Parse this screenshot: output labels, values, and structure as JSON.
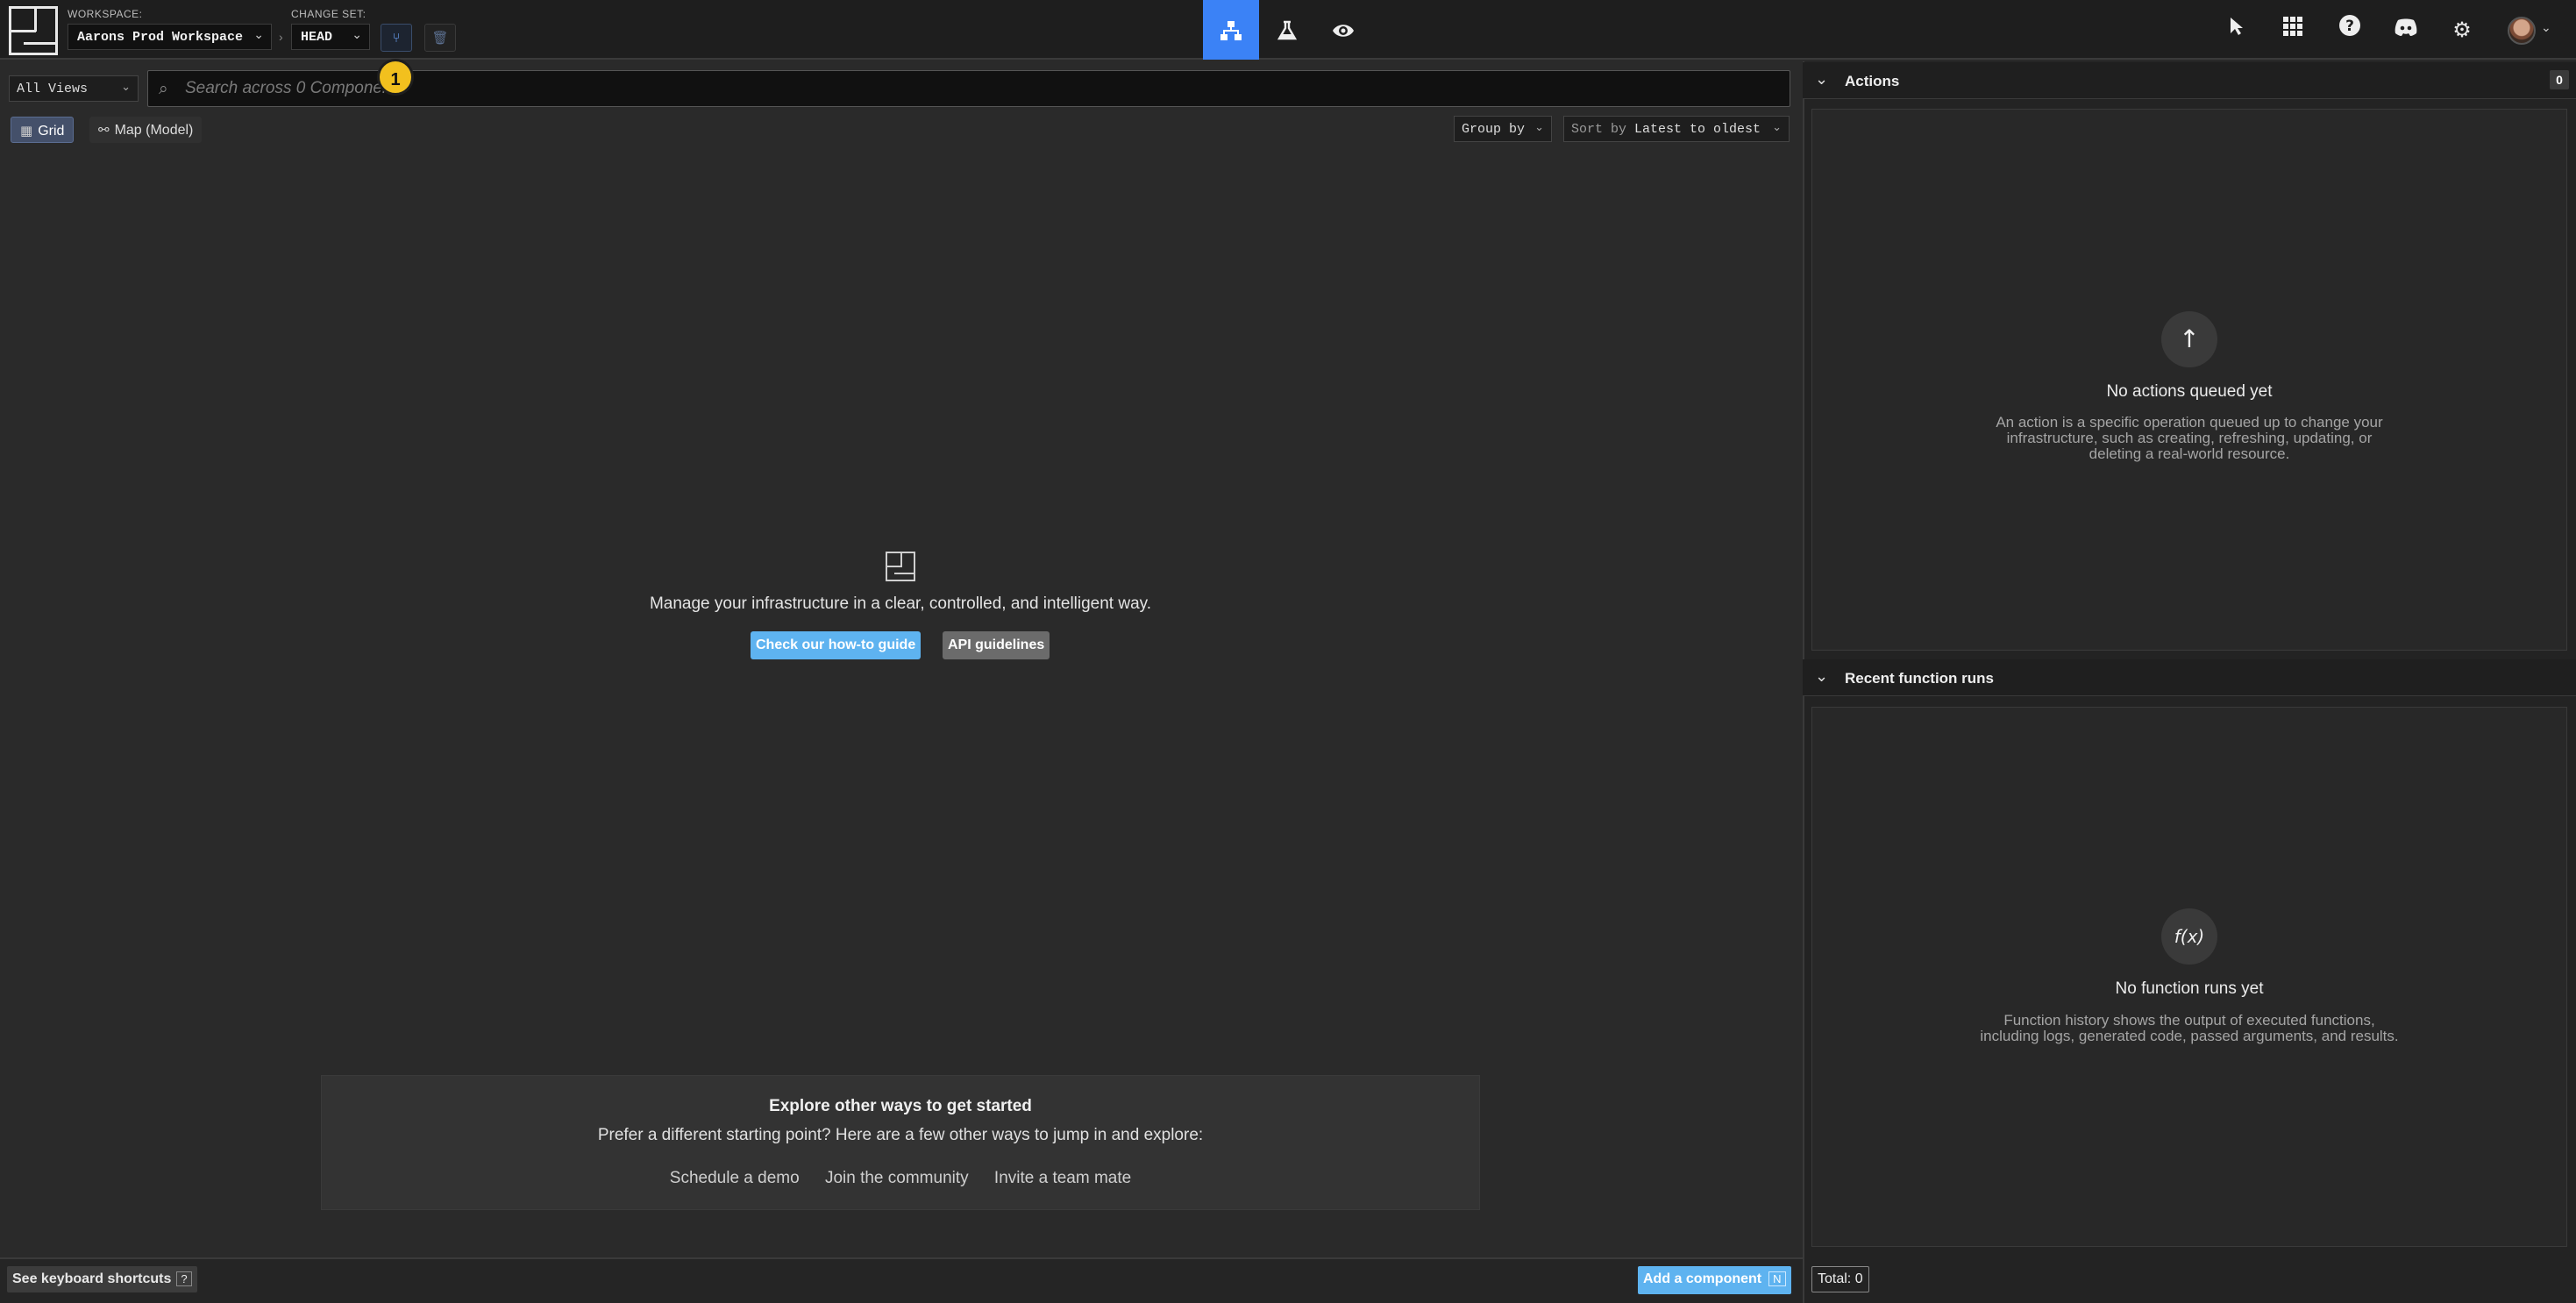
{
  "topbar": {
    "workspace_label": "WORKSPACE:",
    "workspace_value": "Aarons Prod Workspace",
    "changeset_label": "CHANGE SET:",
    "changeset_value": "HEAD",
    "step_badge": "1",
    "mode_buttons": [
      "diagram-model-icon",
      "flask-icon",
      "eye-icon"
    ],
    "right_icons": [
      "cursor-icon",
      "grid-apps-icon",
      "help-icon",
      "discord-icon",
      "gear-icon"
    ]
  },
  "filters": {
    "views_select": "All Views",
    "search_placeholder": "Search across 0 Components",
    "tab_grid": "Grid",
    "tab_map": "Map (Model)",
    "group_by": "Group by",
    "sort_prefix": "Sort by",
    "sort_value": "Latest to oldest"
  },
  "empty_state": {
    "message": "Manage your infrastructure in a clear, controlled, and intelligent way.",
    "guide_button": "Check our how-to guide",
    "api_button": "API guidelines"
  },
  "explore": {
    "title": "Explore other ways to get started",
    "subtitle": "Prefer a different starting point? Here are a few other ways to jump in and explore:",
    "links": [
      "Schedule a demo",
      "Join the community",
      "Invite a team mate"
    ]
  },
  "bottombar": {
    "shortcuts_label": "See keyboard shortcuts",
    "shortcuts_key": "?",
    "add_component_label": "Add a component",
    "add_component_key": "N"
  },
  "actions_panel": {
    "title": "Actions",
    "count": "0",
    "empty_title": "No actions queued yet",
    "empty_desc": "An action is a specific operation queued up to change your infrastructure, such as creating, refreshing, updating, or deleting a real-world resource."
  },
  "functions_panel": {
    "title": "Recent function runs",
    "icon_text": "f(x)",
    "empty_title": "No function runs yet",
    "empty_desc": "Function history shows the output of executed functions, including logs, generated code, passed arguments, and results.",
    "total": "Total: 0"
  }
}
